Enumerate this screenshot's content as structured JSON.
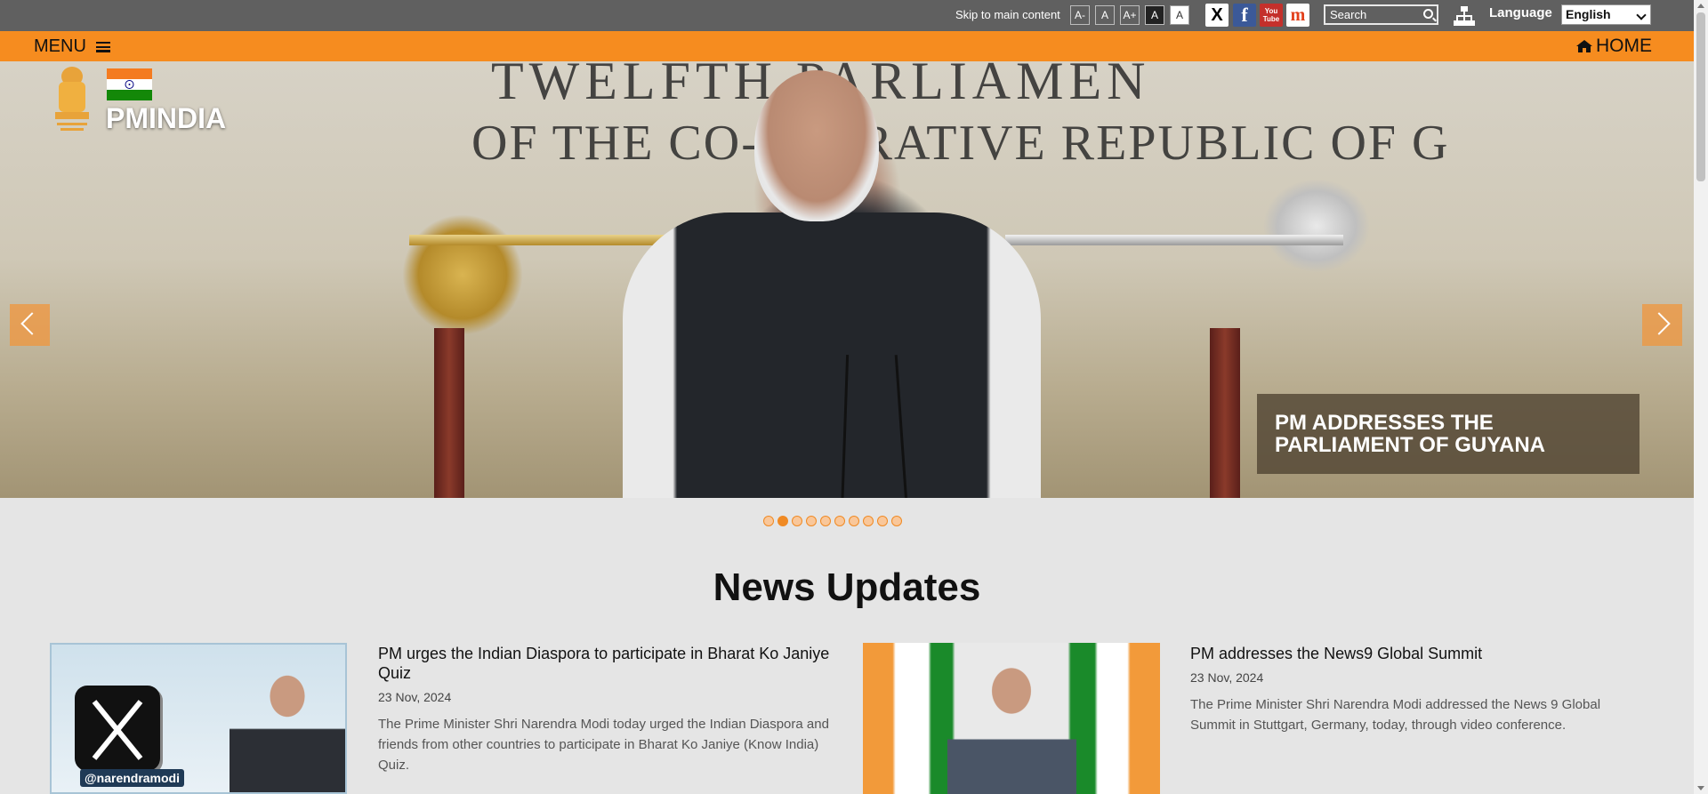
{
  "topbar": {
    "skip_link": "Skip to main content",
    "font_controls": [
      "A-",
      "A",
      "A+",
      "A",
      "A"
    ],
    "social": [
      {
        "icon": "x-icon",
        "glyph": "X"
      },
      {
        "icon": "facebook-icon",
        "glyph": "f"
      },
      {
        "icon": "youtube-icon",
        "glyph": "You Tube"
      },
      {
        "icon": "namo-app-icon",
        "glyph": "m"
      }
    ],
    "search_placeholder": "Search",
    "language_label": "Language",
    "language_selected": "English"
  },
  "menubar": {
    "menu_label": "MENU",
    "home_label": "HOME"
  },
  "header": {
    "logo_text": "PMINDIA"
  },
  "hero": {
    "backdrop_line1": "TWELFTH PARLIAMEN",
    "backdrop_line2": "OF THE CO-OPERATIVE REPUBLIC OF G",
    "caption": "PM ADDRESSES THE PARLIAMENT OF GUYANA",
    "slides_count": 10,
    "active_slide": 2
  },
  "news": {
    "section_title": "News Updates",
    "items": [
      {
        "title": "PM urges the Indian Diaspora to participate in Bharat Ko Janiye Quiz",
        "date": "23 Nov, 2024",
        "summary": "The Prime Minister Shri Narendra Modi today urged the Indian Diaspora and friends from other countries to participate in Bharat Ko Janiye (Know India) Quiz.",
        "image_badge": "@narendramodi"
      },
      {
        "title": "PM addresses the News9 Global Summit",
        "date": "23 Nov, 2024",
        "summary": "The Prime Minister Shri Narendra Modi addressed the News 9 Global Summit in Stuttgart, Germany, today, through video conference."
      }
    ]
  },
  "colors": {
    "topbar_bg": "#606060",
    "accent_orange": "#f68c1f",
    "page_bg": "#e5e5e5"
  }
}
